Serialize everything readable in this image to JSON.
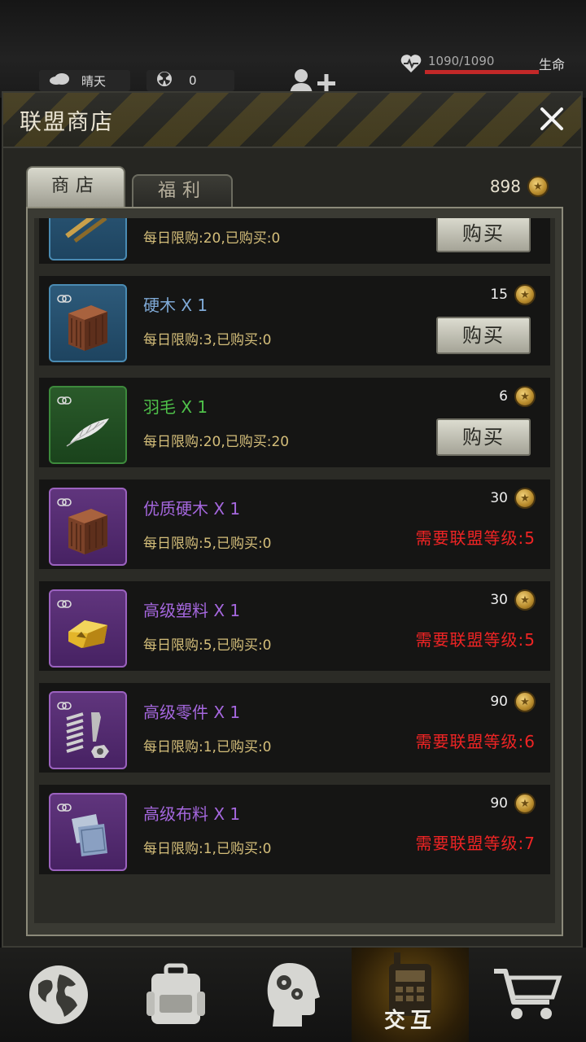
{
  "status_bar": {
    "weather": "晴天",
    "radiation": "0",
    "hp": "1090/1090",
    "hp_label": "生命",
    "hp_fraction": 1.0
  },
  "modal": {
    "title": "联盟商店",
    "close_icon": "close-icon",
    "tabs": [
      {
        "label": "商店",
        "active": true
      },
      {
        "label": "福利",
        "active": false
      }
    ],
    "balance": "898"
  },
  "items": [
    {
      "name": "",
      "limit": "每日限购:20,已购买:0",
      "price": "",
      "rarity": "blue",
      "icon": "tool-icon",
      "action": "buy",
      "buy_label": "购买"
    },
    {
      "name": "硬木 X 1",
      "limit": "每日限购:3,已购买:0",
      "price": "15",
      "rarity": "blue",
      "icon": "wood-block-icon",
      "action": "buy",
      "buy_label": "购买"
    },
    {
      "name": "羽毛 X 1",
      "limit": "每日限购:20,已购买:20",
      "price": "6",
      "rarity": "green",
      "icon": "feather-icon",
      "action": "buy",
      "buy_label": "购买"
    },
    {
      "name": "优质硬木 X 1",
      "limit": "每日限购:5,已购买:0",
      "price": "30",
      "rarity": "purple",
      "icon": "wood-block-icon",
      "action": "locked",
      "requirement": "需要联盟等级:5"
    },
    {
      "name": "高级塑料 X 1",
      "limit": "每日限购:5,已购买:0",
      "price": "30",
      "rarity": "purple",
      "icon": "plastic-icon",
      "action": "locked",
      "requirement": "需要联盟等级:5"
    },
    {
      "name": "高级零件 X 1",
      "limit": "每日限购:1,已购买:0",
      "price": "90",
      "rarity": "purple",
      "icon": "parts-icon",
      "action": "locked",
      "requirement": "需要联盟等级:6"
    },
    {
      "name": "高级布料 X 1",
      "limit": "每日限购:1,已购买:0",
      "price": "90",
      "rarity": "purple",
      "icon": "cloth-icon",
      "action": "locked",
      "requirement": "需要联盟等级:7"
    }
  ],
  "colors": {
    "blue_name": "#7fa9d6",
    "green_name": "#4fc24a",
    "purple_name": "#a567de",
    "requirement": "#ee2424"
  },
  "bottom_nav": [
    {
      "icon": "globe-icon"
    },
    {
      "icon": "backpack-icon"
    },
    {
      "icon": "head-gears-icon"
    },
    {
      "icon": "walkie-talkie-icon",
      "label": "交互",
      "active": true
    },
    {
      "icon": "cart-icon"
    }
  ]
}
